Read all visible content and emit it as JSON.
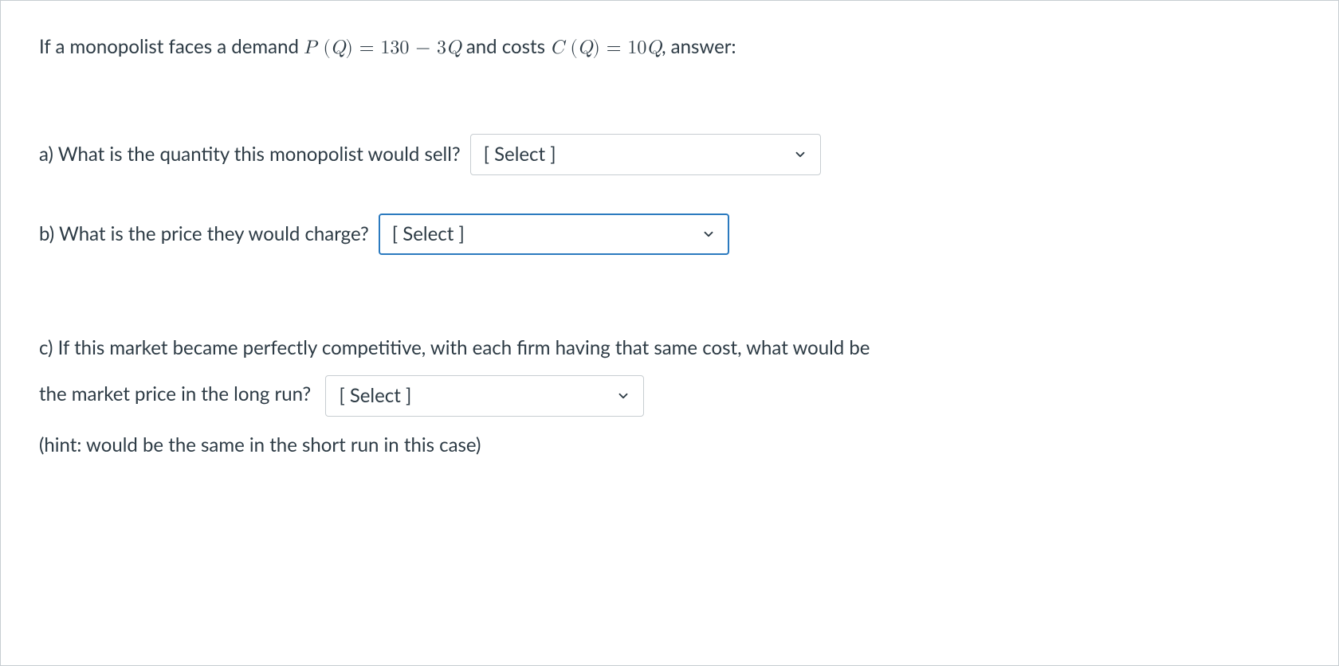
{
  "intro": {
    "prefix": "If a monopolist faces a demand ",
    "demand_fn_var": "P",
    "demand_fn_arg": "Q",
    "demand_eq": " = 130 − 3",
    "demand_tail_var": "Q",
    "mid": " and costs ",
    "cost_fn_var": "C",
    "cost_fn_arg": "Q",
    "cost_eq": " = 10",
    "cost_tail_var": "Q",
    "suffix": ", answer:"
  },
  "questions": {
    "a": {
      "label": "a) What is the quantity this monopolist would sell?",
      "select_placeholder": "[ Select ]"
    },
    "b": {
      "label": "b) What is the price they would charge?",
      "select_placeholder": "[ Select ]"
    },
    "c": {
      "label_part1": "c) If this market became perfectly competitive, with each firm having that same cost, what would be",
      "label_part2": "the market price in the long run?",
      "select_placeholder": "[ Select ]",
      "hint": "(hint: would be the same in the short run in this case)"
    }
  }
}
